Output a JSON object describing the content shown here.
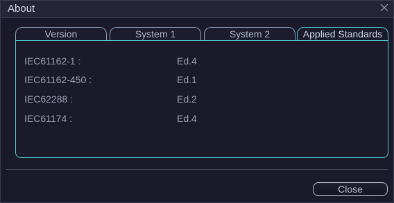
{
  "window": {
    "title": "About"
  },
  "tabs": [
    {
      "label": "Version",
      "active": false
    },
    {
      "label": "System 1",
      "active": false
    },
    {
      "label": "System 2",
      "active": false
    },
    {
      "label": "Applied Standards",
      "active": true
    }
  ],
  "standards": [
    {
      "name": "IEC61162-1 :",
      "edition": "Ed.4"
    },
    {
      "name": "IEC61162-450 :",
      "edition": "Ed.1"
    },
    {
      "name": "IEC62288 :",
      "edition": "Ed.2"
    },
    {
      "name": "IEC61174 :",
      "edition": "Ed.4"
    }
  ],
  "footer": {
    "close_label": "Close"
  },
  "colors": {
    "accent": "#4ec8d6",
    "background": "#1a1a2b",
    "text": "#9aa0b0"
  },
  "icons": {
    "close": "close-icon"
  }
}
